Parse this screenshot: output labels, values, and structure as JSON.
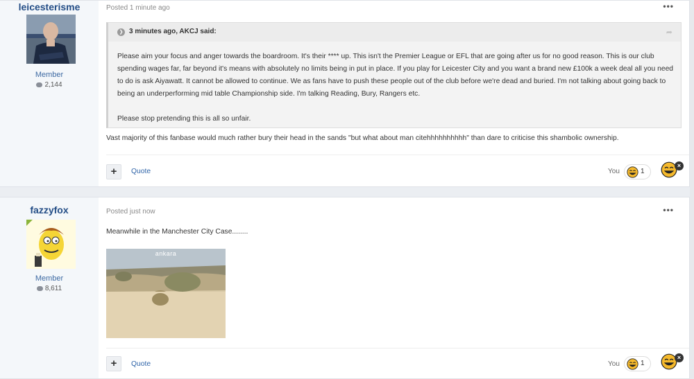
{
  "posts": [
    {
      "author": "leicesterisme",
      "rank": "Member",
      "post_count": "2,144",
      "posted": "Posted 1 minute ago",
      "more": "•••",
      "quote": {
        "cite": "3 minutes ago, AKCJ said:",
        "paragraph1": "Please aim your focus and anger towards the boardroom. It's their **** up. This isn't the Premier League or EFL that are going after us for no good reason. This is our club spending wages far, far beyond it's means with absolutely no limits being in put in place. If you play for Leicester City and you want a brand new £100k a week deal all you need to do is ask Aiyawatt. It cannot be allowed to continue. We as fans have to push these people out of the club before we're dead and buried. I'm not talking about going back to being an underperforming mid table Championship side. I'm talking Reading, Bury, Rangers etc.",
        "paragraph2": "Please stop pretending this is all so unfair."
      },
      "text": "Vast majority of this fanbase would much rather bury their head in the sands \"but what about man citehhhhhhhhhh\" than dare to criticise this shambolic ownership.",
      "actions": {
        "plus": "+",
        "quote": "Quote",
        "you": "You",
        "reaction_count": "1",
        "remove": "×"
      }
    },
    {
      "author": "fazzyfox",
      "rank": "Member",
      "post_count": "8,611",
      "posted": "Posted just now",
      "more": "•••",
      "text": "Meanwhile in the Manchester City Case........",
      "media_caption": "ankara",
      "actions": {
        "plus": "+",
        "quote": "Quote",
        "you": "You",
        "reaction_count": "1",
        "remove": "×"
      }
    }
  ],
  "colors": {
    "username": "#234d86",
    "link": "#2f64a8",
    "online": "#8ab43a"
  },
  "icons": {
    "reaction": "laughing-emoji-icon",
    "comment": "speech-bubble-icon",
    "quote": "quote-icon",
    "share": "share-icon"
  }
}
